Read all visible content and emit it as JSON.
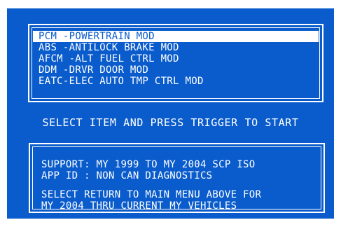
{
  "menu": {
    "items": [
      {
        "label": "PCM  -POWERTRAIN MOD",
        "selected": true
      },
      {
        "label": "ABS  -ANTILOCK BRAKE MOD",
        "selected": false
      },
      {
        "label": "AFCM -ALT FUEL CTRL MOD",
        "selected": false
      },
      {
        "label": "DDM  -DRVR DOOR MOD",
        "selected": false
      },
      {
        "label": "EATC-ELEC AUTO TMP CTRL MOD",
        "selected": false
      }
    ]
  },
  "prompt": "SELECT ITEM AND PRESS TRIGGER TO START",
  "info": {
    "support": "SUPPORT:  MY 1999 TO MY 2004 SCP ISO",
    "app_id": "APP ID   :  NON CAN DIAGNOSTICS",
    "note_line1": "SELECT RETURN TO MAIN MENU ABOVE FOR",
    "note_line2": "MY 2004 THRU CURRENT MY VEHICLES"
  },
  "colors": {
    "screen_background": "#0a5ccc",
    "text": "#ffffff",
    "selection_background": "#ffffff"
  }
}
